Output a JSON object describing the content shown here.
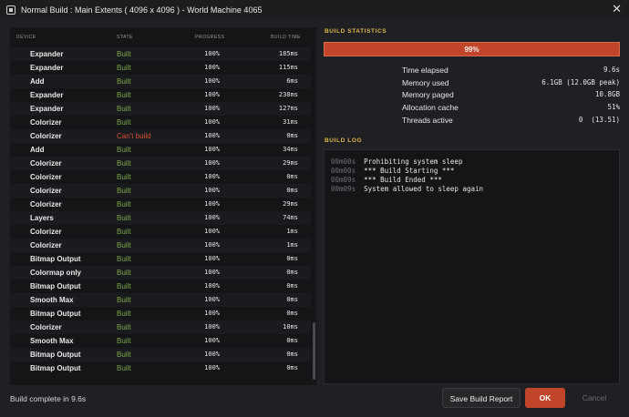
{
  "window": {
    "title": "Normal Build : Main Extents ( 4096 x 4096 ) - World Machine 4065",
    "close_glyph": "✕"
  },
  "table": {
    "headers": {
      "device": "DEVICE",
      "state": "STATE",
      "progress": "PROGRESS",
      "build_time": "BUILD TIME"
    },
    "rows": [
      {
        "device": "Expander",
        "state": "Built",
        "progress": "100%",
        "time": "185ms"
      },
      {
        "device": "Expander",
        "state": "Built",
        "progress": "100%",
        "time": "115ms"
      },
      {
        "device": "Add",
        "state": "Built",
        "progress": "100%",
        "time": "6ms"
      },
      {
        "device": "Expander",
        "state": "Built",
        "progress": "100%",
        "time": "238ms"
      },
      {
        "device": "Expander",
        "state": "Built",
        "progress": "100%",
        "time": "127ms"
      },
      {
        "device": "Colorizer",
        "state": "Built",
        "progress": "100%",
        "time": "31ms"
      },
      {
        "device": "Colorizer",
        "state": "Can't build",
        "progress": "100%",
        "time": "0ms"
      },
      {
        "device": "Add",
        "state": "Built",
        "progress": "100%",
        "time": "34ms"
      },
      {
        "device": "Colorizer",
        "state": "Built",
        "progress": "100%",
        "time": "29ms"
      },
      {
        "device": "Colorizer",
        "state": "Built",
        "progress": "100%",
        "time": "0ms"
      },
      {
        "device": "Colorizer",
        "state": "Built",
        "progress": "100%",
        "time": "0ms"
      },
      {
        "device": "Colorizer",
        "state": "Built",
        "progress": "100%",
        "time": "29ms"
      },
      {
        "device": "Layers",
        "state": "Built",
        "progress": "100%",
        "time": "74ms"
      },
      {
        "device": "Colorizer",
        "state": "Built",
        "progress": "100%",
        "time": "1ms"
      },
      {
        "device": "Colorizer",
        "state": "Built",
        "progress": "100%",
        "time": "1ms"
      },
      {
        "device": "Bitmap Output",
        "state": "Built",
        "progress": "100%",
        "time": "0ms"
      },
      {
        "device": "Colormap only",
        "state": "Built",
        "progress": "100%",
        "time": "0ms"
      },
      {
        "device": "Bitmap Output",
        "state": "Built",
        "progress": "100%",
        "time": "0ms"
      },
      {
        "device": "Smooth Max",
        "state": "Built",
        "progress": "100%",
        "time": "0ms"
      },
      {
        "device": "Bitmap Output",
        "state": "Built",
        "progress": "100%",
        "time": "0ms"
      },
      {
        "device": "Colorizer",
        "state": "Built",
        "progress": "100%",
        "time": "10ms"
      },
      {
        "device": "Smooth Max",
        "state": "Built",
        "progress": "100%",
        "time": "0ms"
      },
      {
        "device": "Bitmap Output",
        "state": "Built",
        "progress": "100%",
        "time": "0ms"
      },
      {
        "device": "Bitmap Output",
        "state": "Built",
        "progress": "100%",
        "time": "0ms"
      }
    ]
  },
  "build_statistics": {
    "title": "BUILD STATISTICS",
    "progress_label": "99%",
    "progress_value": 0.99,
    "stats": [
      {
        "label": "Time elapsed",
        "value": "9.6s"
      },
      {
        "label": "Memory used",
        "value": "6.1GB (12.0GB peak)"
      },
      {
        "label": "Memory paged",
        "value": "10.8GB"
      },
      {
        "label": "Allocation cache",
        "value": "51%"
      },
      {
        "label": "Threads active",
        "value": "0  (13.51)"
      }
    ]
  },
  "build_log": {
    "title": "BUILD LOG",
    "lines": [
      {
        "ts": "00m00s",
        "msg": "Prohibiting system sleep"
      },
      {
        "ts": "00m00s",
        "msg": "*** Build Starting ***"
      },
      {
        "ts": "00m09s",
        "msg": "*** Build Ended ***"
      },
      {
        "ts": "00m09s",
        "msg": "System allowed to sleep again"
      }
    ]
  },
  "footer": {
    "status": "Build complete in 9.6s",
    "save_report_label": "Save Build Report",
    "ok_label": "OK",
    "cancel_label": "Cancel"
  },
  "colors": {
    "accent": "#c0452a",
    "section_title": "#e0b54a",
    "built": "#7fa84a",
    "failed": "#d4513a"
  }
}
